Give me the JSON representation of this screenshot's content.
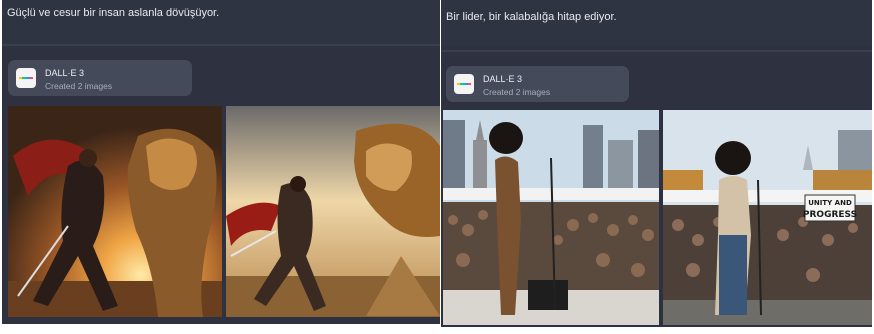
{
  "left_panel": {
    "prompt": "Güçlü ve cesur bir insan aslanla dövüşüyor.",
    "card": {
      "title": "DALL·E 3",
      "subtitle": "Created 2 images",
      "icon": "dalle-logo-icon"
    }
  },
  "right_panel": {
    "prompt": "Bir lider, bir kalabalığa hitap ediyor.",
    "card": {
      "title": "DALL·E 3",
      "subtitle": "Created 2 images",
      "icon": "dalle-logo-icon"
    },
    "sign_text": [
      "UNITY AND",
      "PROGRESS"
    ]
  },
  "colors": {
    "panel_bg": "#2e3240",
    "card_bg": "#454a5a",
    "text": "#e9eaef",
    "subtext": "#a8adbb"
  }
}
